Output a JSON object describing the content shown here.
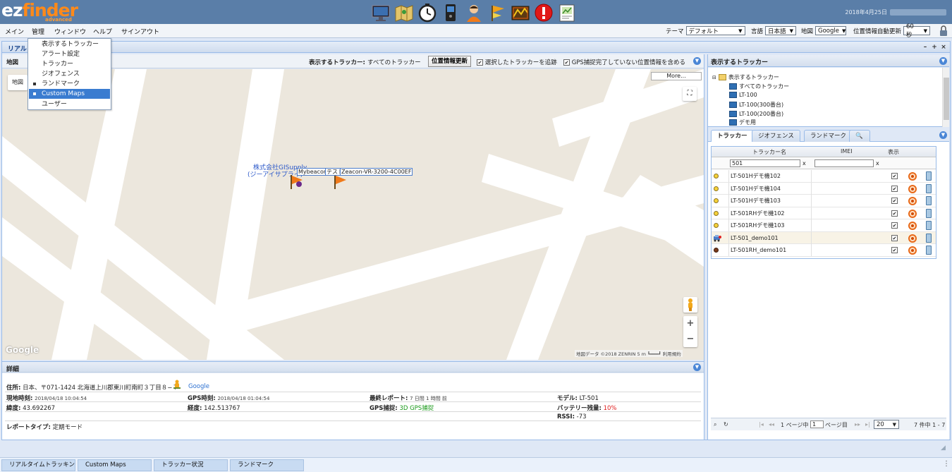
{
  "header": {
    "logo_main": "ez",
    "logo_accent": "finder",
    "logo_sub": "advanced",
    "date": "2018年4月25日",
    "app_icons": [
      "monitor-icon",
      "map-icon",
      "clock-icon",
      "device-icon",
      "user-icon",
      "flag-icon",
      "custom-map-icon",
      "alert-icon",
      "report-icon"
    ]
  },
  "menu": {
    "items": [
      "メイン",
      "管理",
      "ウィンドウ",
      "ヘルプ",
      "サインアウト"
    ],
    "theme_label": "テーマ",
    "theme_value": "デフォルト",
    "lang_label": "言語",
    "lang_value": "日本語",
    "map_label": "地図",
    "map_value": "Google",
    "refresh_label": "位置情報自動更新",
    "refresh_value": "60 秒"
  },
  "dropdown": {
    "items": [
      {
        "label": "表示するトラッカー",
        "marked": false,
        "active": false
      },
      {
        "label": "アラート設定",
        "marked": false,
        "active": false
      },
      {
        "label": "トラッカー",
        "marked": false,
        "active": false
      },
      {
        "label": "ジオフェンス",
        "marked": false,
        "active": false
      },
      {
        "label": "ランドマーク",
        "marked": true,
        "active": false
      },
      {
        "label": "Custom Maps",
        "marked": true,
        "active": true
      },
      {
        "label": "ユーザー",
        "marked": false,
        "active": false
      }
    ]
  },
  "panel": {
    "title": "リアル"
  },
  "map_toolbar": {
    "title": "地図",
    "show_trackers_label": "表示するトラッカー:",
    "show_trackers_value": "すべてのトラッカー",
    "refresh_button": "位置情報更新",
    "follow_selected": "選択したトラッカーを追跡",
    "include_gps": "GPS捕捉完了していない位置情報を含める"
  },
  "map": {
    "type_button": "地図",
    "more_button": "More...",
    "label_line1": "株式会社GISupply",
    "label_line2": "(ジーアイサプライ)",
    "tag1": "Mybeacon",
    "tag2": "テスト",
    "tag3": "Zeacon-VR-3200-4C00EF",
    "google": "Google",
    "attribution": "地図データ ©2018 ZENRIN   5 m ┗━━━┛   利用規約"
  },
  "details": {
    "title": "詳細",
    "address_label": "住所:",
    "address_value": "日本、〒071-1424 北海道上川郡東川町南町３丁目８−７",
    "google_link": "Google",
    "current_time_label": "現地時刻:",
    "current_time_value": "2018/04/18 10:04:54",
    "gps_time_label": "GPS時刻:",
    "gps_time_value": "2018/04/18 01:04:54",
    "last_report_label": "最終レポート:",
    "last_report_value": "7 日間 1 時間 前",
    "model_label": "モデル:",
    "model_value": "LT-501",
    "lat_label": "緯度:",
    "lat_value": "43.692267",
    "lon_label": "経度:",
    "lon_value": "142.513767",
    "gps_fix_label": "GPS捕捉:",
    "gps_fix_value": "3D GPS捕捉",
    "battery_label": "バッテリー残量:",
    "battery_value": "10%",
    "rssi_label": "RSSI:",
    "rssi_value": "-73",
    "report_type_label": "レポートタイプ:",
    "report_type_value": "定期モード"
  },
  "right_panel": {
    "title": "表示するトラッカー",
    "tree": [
      "表示するトラッカー",
      "すべてのトラッカー",
      "LT-100",
      "LT-100(300番台)",
      "LT-100(200番台)",
      "デモ用"
    ],
    "tabs": [
      "トラッカー",
      "ジオフェンス",
      "ランドマーク"
    ],
    "grid": {
      "col_name": "トラッカー名",
      "col_imei": "IMEI",
      "col_show": "表示",
      "filter_name": "501",
      "filter_clear": "x",
      "rows": [
        {
          "name": "LT-501Hデモ機102",
          "status": "yellow"
        },
        {
          "name": "LT-501Hデモ機104",
          "status": "yellow"
        },
        {
          "name": "LT-501Hデモ機103",
          "status": "yellow"
        },
        {
          "name": "LT-501RHデモ機102",
          "status": "yellow"
        },
        {
          "name": "LT-501RHデモ機103",
          "status": "yellow"
        },
        {
          "name": "LT-501_demo101",
          "status": "vehicle"
        },
        {
          "name": "LT-501RH_demo101",
          "status": "dark"
        }
      ]
    },
    "pager": {
      "page_prefix": "1 ページ中",
      "page_value": "1",
      "page_suffix": "ページ目",
      "page_size": "20",
      "count": "7 件中 1 - 7"
    }
  },
  "taskbar": {
    "items": [
      "リアルタイムトラッキン",
      "Custom Maps",
      "トラッカー状況",
      "ランドマーク"
    ]
  },
  "colors": {
    "header_bg": "#5a7ea8",
    "accent_blue": "#3a7cd0",
    "map_bg": "#ece7dd",
    "gps_green": "#1a9a1a",
    "battery_red": "#e02020"
  }
}
